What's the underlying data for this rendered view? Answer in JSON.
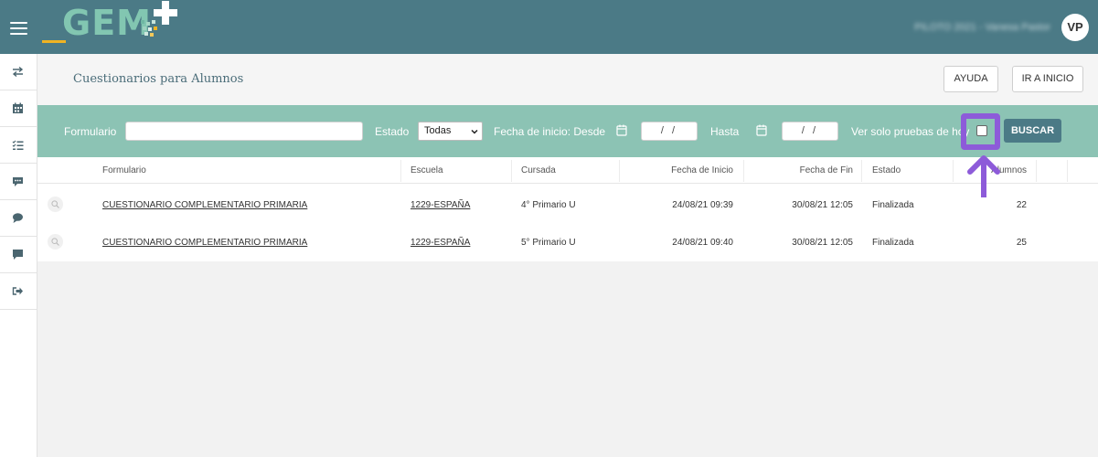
{
  "header": {
    "logo_text": "GEM",
    "user_name": "PILOTO 2021 - Vanesa Pastor",
    "avatar_initials": "VP",
    "colors": {
      "bar": "#4b7a86",
      "logo": "#82c6b1",
      "accent": "#f0b323"
    }
  },
  "sidebar": {
    "items": [
      {
        "icon": "swap-arrows-icon"
      },
      {
        "icon": "calendar-icon"
      },
      {
        "icon": "checklist-icon"
      },
      {
        "icon": "chat-dots-icon"
      },
      {
        "icon": "chat-bubble-icon"
      },
      {
        "icon": "comment-icon"
      },
      {
        "icon": "sign-out-icon"
      }
    ]
  },
  "page": {
    "title": "Cuestionarios para Alumnos",
    "help_label": "AYUDA",
    "home_label": "IR A INICIO"
  },
  "filters": {
    "formulario_label": "Formulario",
    "formulario_value": "",
    "estado_label": "Estado",
    "estado_selected": "Todas",
    "fecha_desde_label": "Fecha de inicio: Desde",
    "fecha_desde_value": "/ /",
    "hasta_label": "Hasta",
    "hasta_value": "/ /",
    "solo_hoy_label": "Ver solo pruebas de hoy",
    "solo_hoy_checked": false,
    "search_label": "BUSCAR",
    "colors": {
      "bar": "#8cc3b4",
      "highlight": "#8d5bd9"
    }
  },
  "table": {
    "columns": [
      "Formulario",
      "Escuela",
      "Cursada",
      "Fecha de Inicio",
      "Fecha de Fin",
      "Estado",
      "Alumnos"
    ],
    "rows": [
      {
        "formulario": "CUESTIONARIO COMPLEMENTARIO PRIMARIA",
        "escuela": "1229-ESPAÑA",
        "cursada": "4° Primario U",
        "inicio": "24/08/21 09:39",
        "fin": "30/08/21 12:05",
        "estado": "Finalizada",
        "alumnos": "22"
      },
      {
        "formulario": "CUESTIONARIO COMPLEMENTARIO PRIMARIA",
        "escuela": "1229-ESPAÑA",
        "cursada": "5° Primario U",
        "inicio": "24/08/21 09:40",
        "fin": "30/08/21 12:05",
        "estado": "Finalizada",
        "alumnos": "25"
      }
    ]
  }
}
